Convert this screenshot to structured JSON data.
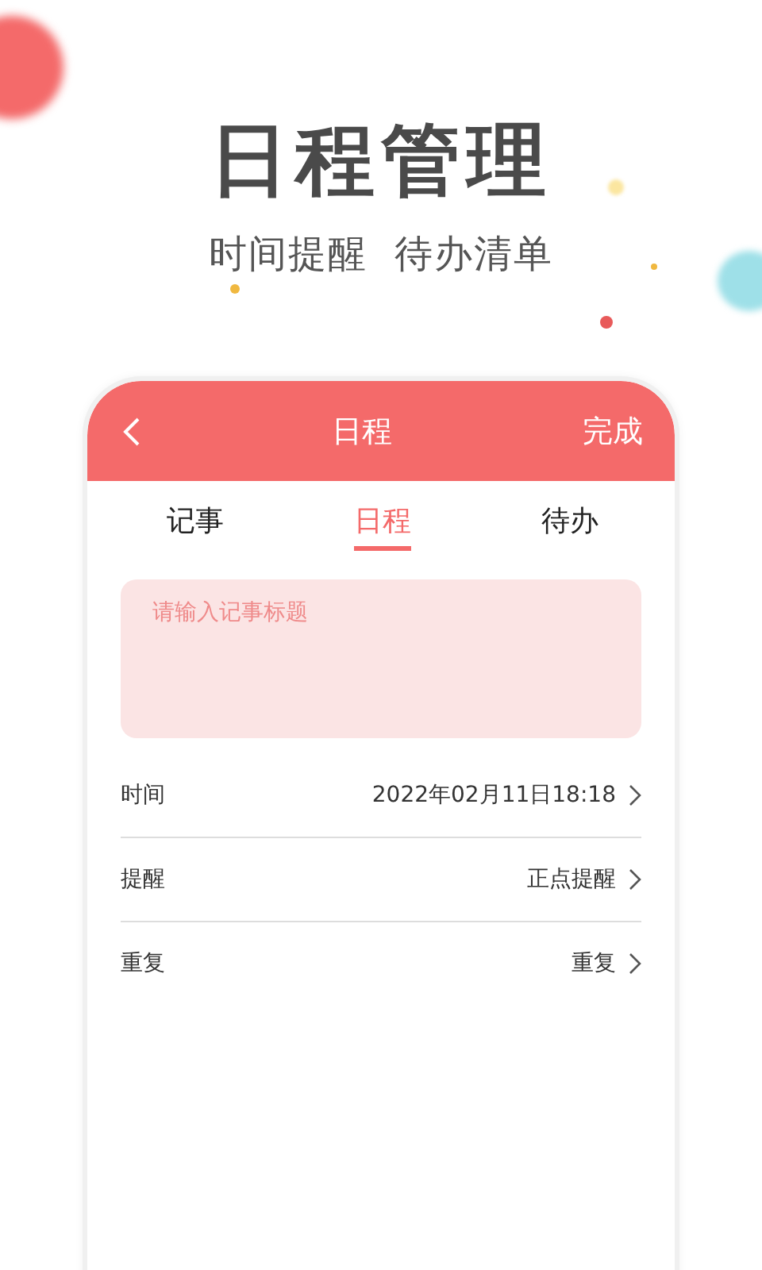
{
  "headline": "日程管理",
  "subtitle": "时间提醒  待办清单",
  "header": {
    "title": "日程",
    "action": "完成"
  },
  "tabs": [
    {
      "label": "记事",
      "selected": false
    },
    {
      "label": "日程",
      "selected": true
    },
    {
      "label": "待办",
      "selected": false
    }
  ],
  "title_field": {
    "placeholder": "请输入记事标题"
  },
  "rows": [
    {
      "label": "时间",
      "value": "2022年02月11日18:18"
    },
    {
      "label": "提醒",
      "value": "正点提醒"
    },
    {
      "label": "重复",
      "value": "重复"
    }
  ]
}
